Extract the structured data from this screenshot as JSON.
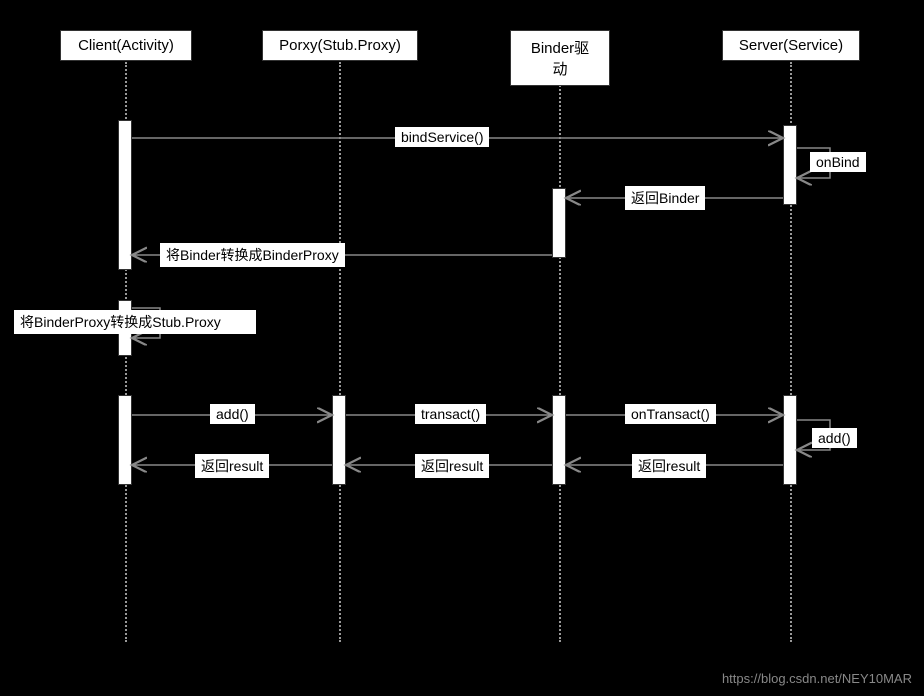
{
  "participants": {
    "client": "Client(Activity)",
    "proxy": "Porxy(Stub.Proxy)",
    "binder": "Binder驱动",
    "server": "Server(Service)"
  },
  "messages": {
    "bindService": "bindService()",
    "onBind": "onBind",
    "returnBinder": "返回Binder",
    "toBinderProxy": "将Binder转换成BinderProxy",
    "toStubProxy": "将BinderProxy转换成Stub.Proxy",
    "add1": "add()",
    "transact": "transact()",
    "onTransact": "onTransact()",
    "add2": "add()",
    "returnResult1": "返回result",
    "returnResult2": "返回result",
    "returnResult3": "返回result"
  },
  "watermark": "https://blog.csdn.net/NEY10MAR"
}
